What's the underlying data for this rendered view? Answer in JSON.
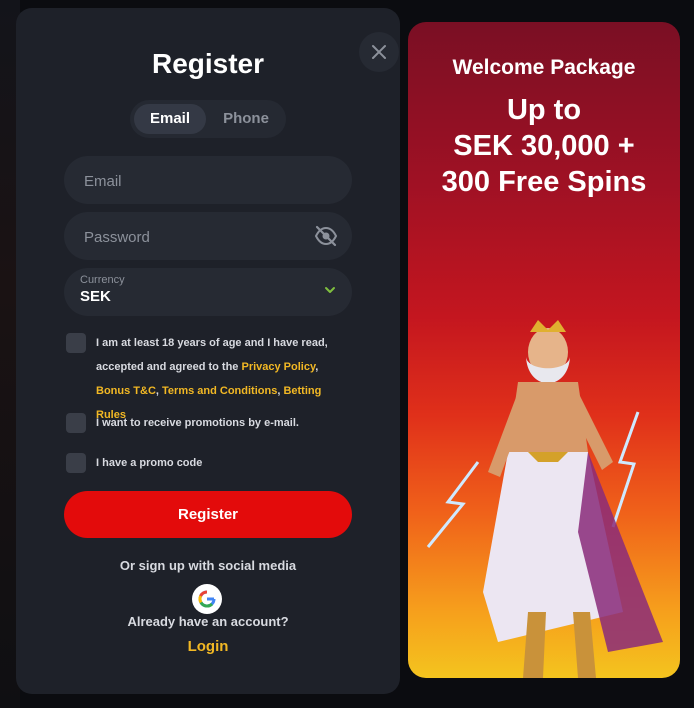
{
  "modal": {
    "title": "Register",
    "tabs": [
      {
        "label": "Email",
        "active": true
      },
      {
        "label": "Phone",
        "active": false
      }
    ],
    "email_field": {
      "placeholder": "Email",
      "value": ""
    },
    "password_field": {
      "placeholder": "Password",
      "value": ""
    },
    "currency": {
      "label": "Currency",
      "value": "SEK"
    },
    "age_consent": {
      "text_before": "I am at least 18 years of age and I have read, accepted and agreed to the ",
      "link_privacy": "Privacy Policy",
      "sep1": ", ",
      "link_bonus": "Bonus T&C",
      "sep2": ", ",
      "link_terms": "Terms and Conditions",
      "sep3": ", ",
      "link_betting": "Betting Rules"
    },
    "promotions_consent": "I want to receive promotions by e-mail.",
    "promo_code_label": "I have a promo code",
    "register_button": "Register",
    "social_text": "Or sign up with social media",
    "already_text": "Already have an account?",
    "login_link": "Login"
  },
  "promo": {
    "heading": "Welcome Package",
    "amount_line1": "Up to",
    "amount_line2": "SEK 30,000 +",
    "amount_line3": "300 Free Spins"
  },
  "icons": {
    "close": "close-icon",
    "password_toggle": "eye-slash-icon",
    "chevron": "chevron-down-icon",
    "google": "google-icon"
  },
  "colors": {
    "modal_bg": "#1e2129",
    "field_bg": "#262a33",
    "accent_red": "#e30b0b",
    "link_gold": "#f2b824",
    "chevron_green": "#7fbf3f"
  }
}
